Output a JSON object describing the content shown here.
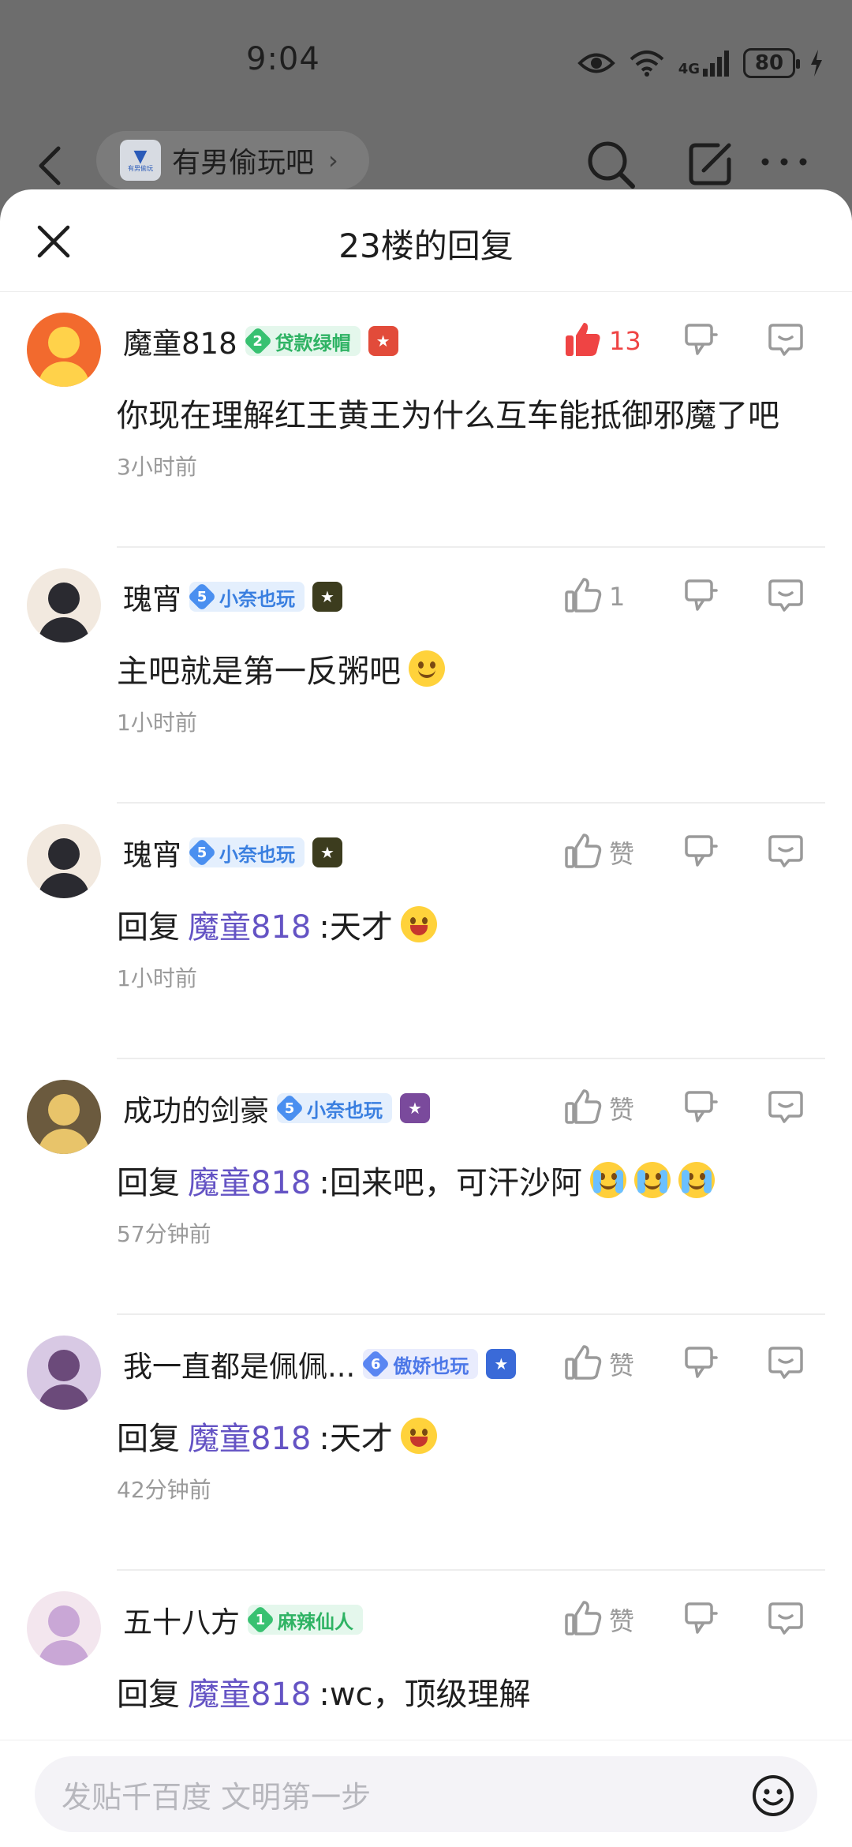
{
  "status_bar": {
    "time": "9:04",
    "network": "4G",
    "battery": "80"
  },
  "nav": {
    "forum_name": "有男偷玩吧",
    "forum_logo_text": "有男偷玩"
  },
  "sheet": {
    "title": "23楼的回复"
  },
  "replies": [
    {
      "username": "魔童818",
      "badge_level": "2",
      "badge_text": "贷款绿帽",
      "badge_color": "green",
      "likes": "13",
      "liked": true,
      "content_prefix": "",
      "mention": "",
      "content": "你现在理解红王黄王为什么互车能抵御邪魔了吧",
      "emojis": [],
      "time": "3小时前"
    },
    {
      "username": "瑰宵",
      "badge_level": "5",
      "badge_text": "小奈也玩",
      "badge_color": "blue",
      "likes": "1",
      "liked": false,
      "content_prefix": "",
      "mention": "",
      "content": "主吧就是第一反粥吧",
      "emojis": [
        "smile"
      ],
      "time": "1小时前"
    },
    {
      "username": "瑰宵",
      "badge_level": "5",
      "badge_text": "小奈也玩",
      "badge_color": "blue",
      "likes": "赞",
      "liked": false,
      "content_prefix": "回复",
      "mention": "魔童818",
      "content": ":天才",
      "emojis": [
        "grin"
      ],
      "time": "1小时前"
    },
    {
      "username": "成功的剑豪",
      "badge_level": "5",
      "badge_text": "小奈也玩",
      "badge_color": "blue",
      "likes": "赞",
      "liked": false,
      "content_prefix": "回复",
      "mention": "魔童818",
      "content": ":回来吧，可汗沙阿",
      "emojis": [
        "cry",
        "cry",
        "cry"
      ],
      "time": "57分钟前"
    },
    {
      "username": "我一直都是佩佩...",
      "badge_level": "6",
      "badge_text": "傲娇也玩",
      "badge_color": "purple",
      "likes": "赞",
      "liked": false,
      "content_prefix": "回复",
      "mention": "魔童818",
      "content": ":天才",
      "emojis": [
        "grin"
      ],
      "time": "42分钟前"
    },
    {
      "username": "五十八方",
      "badge_level": "1",
      "badge_text": "麻辣仙人",
      "badge_color": "green",
      "likes": "赞",
      "liked": false,
      "content_prefix": "回复",
      "mention": "魔童818",
      "content": ":wc，顶级理解",
      "emojis": [],
      "time": ""
    }
  ],
  "composer": {
    "placeholder": "发贴千百度 文明第一步"
  },
  "colors": {
    "mention": "#6453c4",
    "like_active": "#ef4444",
    "muted": "#9a9a9a"
  }
}
